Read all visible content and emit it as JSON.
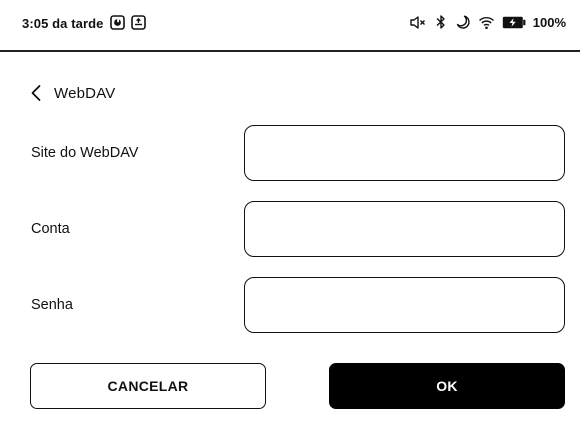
{
  "status_bar": {
    "time": "3:05 da tarde",
    "battery": "100%",
    "icons": [
      "app-indicator-icon",
      "notification-icon",
      "volume-muted-icon",
      "bluetooth-icon",
      "night-mode-icon",
      "wifi-icon",
      "battery-charging-icon"
    ]
  },
  "header": {
    "title": "WebDAV",
    "back_icon": "chevron-left-icon"
  },
  "form": {
    "fields": [
      {
        "label": "Site do WebDAV",
        "value": "",
        "placeholder": ""
      },
      {
        "label": "Conta",
        "value": "",
        "placeholder": ""
      },
      {
        "label": "Senha",
        "value": "",
        "placeholder": ""
      }
    ]
  },
  "actions": {
    "cancel_label": "CANCELAR",
    "ok_label": "OK"
  },
  "colors": {
    "background": "#ffffff",
    "text": "#111111",
    "primary_button": "#000000",
    "primary_button_text": "#ffffff"
  }
}
